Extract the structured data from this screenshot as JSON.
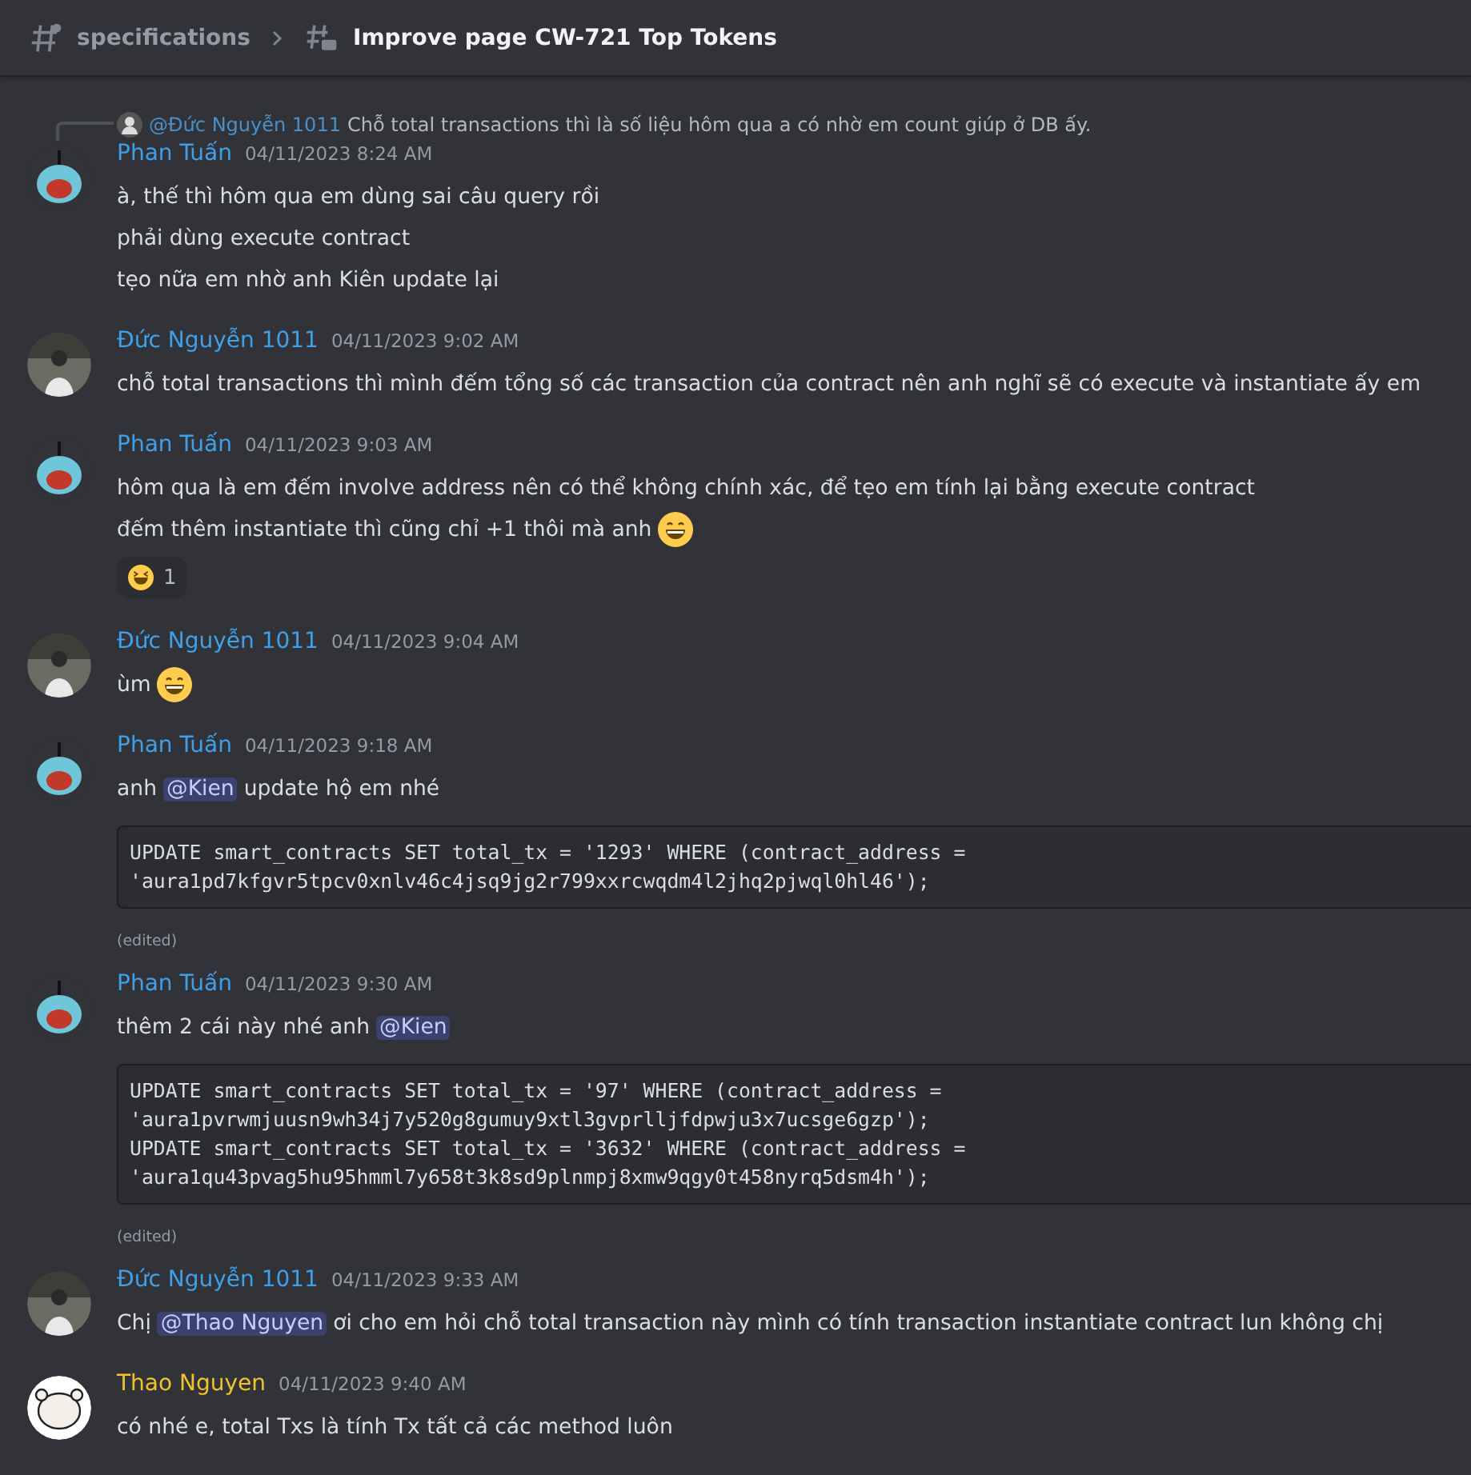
{
  "header": {
    "parent_channel": "specifications",
    "thread_title": "Improve page CW-721 Top Tokens"
  },
  "messages": [
    {
      "author": "Phan Tuấn",
      "color": "#3fa0e8",
      "avatar": {
        "kind": "cartoon"
      },
      "timestamp": "04/11/2023 8:24 AM",
      "reply": {
        "mention": "@Đức Nguyễn 1011",
        "text": "Chỗ total transactions thì là số liệu hôm qua a có nhờ em count giúp ở DB ấy."
      },
      "lines": [
        {
          "kind": "text",
          "parts": [
            {
              "kind": "text",
              "text": "à, thế thì hôm qua em dùng sai câu query rồi"
            }
          ]
        },
        {
          "kind": "text",
          "parts": [
            {
              "kind": "text",
              "text": "phải dùng execute contract"
            }
          ]
        },
        {
          "kind": "text",
          "parts": [
            {
              "kind": "text",
              "text": "tẹo nữa em nhờ anh Kiên update lại"
            }
          ]
        }
      ]
    },
    {
      "author": "Đức Nguyễn 1011",
      "color": "#3fa0e8",
      "avatar": {
        "kind": "photo"
      },
      "timestamp": "04/11/2023 9:02 AM",
      "lines": [
        {
          "kind": "text",
          "parts": [
            {
              "kind": "text",
              "text": "chỗ total transactions thì mình đếm tổng số các transaction của contract nên anh nghĩ sẽ có execute và instantiate ấy em"
            }
          ]
        }
      ]
    },
    {
      "author": "Phan Tuấn",
      "color": "#3fa0e8",
      "avatar": {
        "kind": "cartoon"
      },
      "timestamp": "04/11/2023 9:03 AM",
      "lines": [
        {
          "kind": "text",
          "parts": [
            {
              "kind": "text",
              "text": "hôm qua là em đếm involve address nên có thể không chính xác, để tẹo em tính lại bằng execute contract"
            }
          ]
        },
        {
          "kind": "text",
          "parts": [
            {
              "kind": "text",
              "text": "đếm thêm instantiate thì cũng chỉ +1 thôi mà anh"
            },
            {
              "kind": "emoji"
            }
          ]
        },
        {
          "kind": "reaction",
          "count": "1"
        }
      ]
    },
    {
      "author": "Đức Nguyễn 1011",
      "color": "#3fa0e8",
      "avatar": {
        "kind": "photo"
      },
      "timestamp": "04/11/2023 9:04 AM",
      "lines": [
        {
          "kind": "text",
          "parts": [
            {
              "kind": "text",
              "text": "ùm"
            },
            {
              "kind": "emoji"
            }
          ]
        }
      ]
    },
    {
      "author": "Phan Tuấn",
      "color": "#3fa0e8",
      "avatar": {
        "kind": "cartoon"
      },
      "timestamp": "04/11/2023 9:18 AM",
      "lines": [
        {
          "kind": "text",
          "parts": [
            {
              "kind": "text",
              "text": "anh"
            },
            {
              "kind": "mention",
              "text": "@Kien"
            },
            {
              "kind": "text",
              "text": "update hộ em nhé"
            }
          ]
        },
        {
          "kind": "code",
          "code": [
            "UPDATE smart_contracts SET total_tx = '1293' WHERE (contract_address =",
            "'aura1pd7kfgvr5tpcv0xnlv46c4jsq9jg2r799xxrcwqdm4l2jhq2pjwql0hl46');"
          ]
        },
        {
          "kind": "edited",
          "text": "(edited)"
        }
      ]
    },
    {
      "author": "Phan Tuấn",
      "color": "#3fa0e8",
      "avatar": {
        "kind": "cartoon"
      },
      "timestamp": "04/11/2023 9:30 AM",
      "lines": [
        {
          "kind": "text",
          "parts": [
            {
              "kind": "text",
              "text": "thêm 2 cái này nhé anh"
            },
            {
              "kind": "mention",
              "text": "@Kien"
            }
          ]
        },
        {
          "kind": "code",
          "code": [
            "UPDATE smart_contracts SET total_tx = '97' WHERE (contract_address =",
            "'aura1pvrwmjuusn9wh34j7y520g8gumuy9xtl3gvprlljfdpwju3x7ucsge6gzp');",
            "UPDATE smart_contracts SET total_tx = '3632' WHERE (contract_address =",
            "'aura1qu43pvag5hu95hmml7y658t3k8sd9plnmpj8xmw9qgy0t458nyrq5dsm4h');"
          ]
        },
        {
          "kind": "edited",
          "text": "(edited)"
        }
      ]
    },
    {
      "author": "Đức Nguyễn 1011",
      "color": "#3fa0e8",
      "avatar": {
        "kind": "photo"
      },
      "timestamp": "04/11/2023 9:33 AM",
      "lines": [
        {
          "kind": "text",
          "parts": [
            {
              "kind": "text",
              "text": "Chị"
            },
            {
              "kind": "mention",
              "text": "@Thao Nguyen"
            },
            {
              "kind": "text",
              "text": "ơi cho em hỏi chỗ total transaction này mình có tính transaction instantiate contract lun không chị"
            }
          ]
        }
      ]
    },
    {
      "author": "Thao Nguyen",
      "color": "#f0c32c",
      "avatar": {
        "kind": "bear"
      },
      "timestamp": "04/11/2023 9:40 AM",
      "lines": [
        {
          "kind": "text",
          "parts": [
            {
              "kind": "text",
              "text": "có nhé e, total Txs là tính Tx tất cả các method luôn"
            }
          ]
        }
      ]
    }
  ]
}
